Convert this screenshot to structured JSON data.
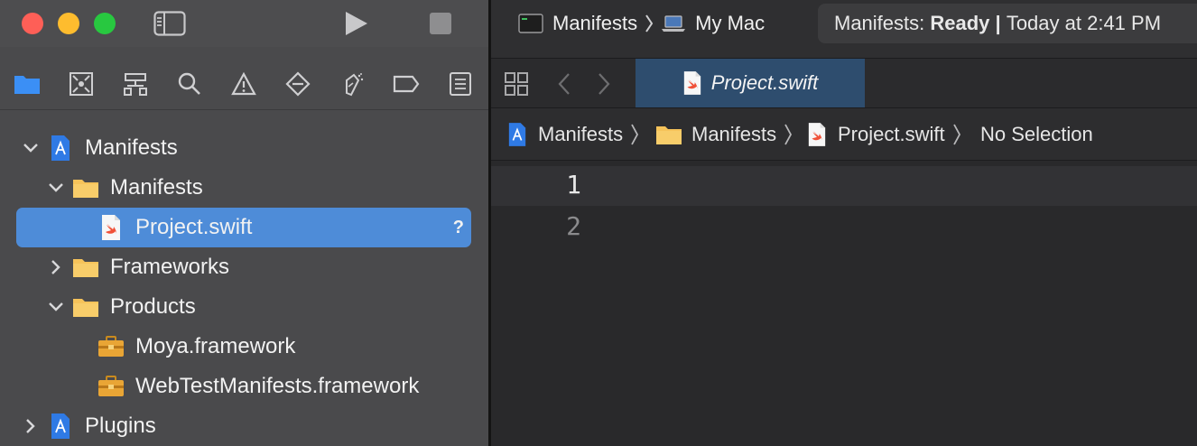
{
  "scheme": {
    "project": "Manifests",
    "destination": "My Mac"
  },
  "status": {
    "prefix": "Manifests: ",
    "state": "Ready",
    "separator": " | ",
    "time": "Today at 2:41 PM"
  },
  "navigator_tabs": [
    "folder-icon",
    "source-control-icon",
    "symbol-icon",
    "find-icon",
    "issue-icon",
    "test-icon",
    "debug-icon",
    "breakpoint-icon",
    "report-icon"
  ],
  "tree": {
    "root": "Manifests",
    "group": "Manifests",
    "selected_file": "Project.swift",
    "selected_badge": "?",
    "frameworks": "Frameworks",
    "products": "Products",
    "product_items": [
      "Moya.framework",
      "WebTestManifests.framework"
    ],
    "plugins": "Plugins"
  },
  "editor_tab": {
    "label": "Project.swift"
  },
  "jumpbar": {
    "items": [
      "Manifests",
      "Manifests",
      "Project.swift",
      "No Selection"
    ]
  },
  "editor": {
    "line_numbers": [
      "1",
      "2"
    ]
  },
  "colors": {
    "selection": "#4e8cd8",
    "active_tab": "#2e4d6e",
    "folder": "#f6c35a",
    "swift": "#f05138"
  }
}
